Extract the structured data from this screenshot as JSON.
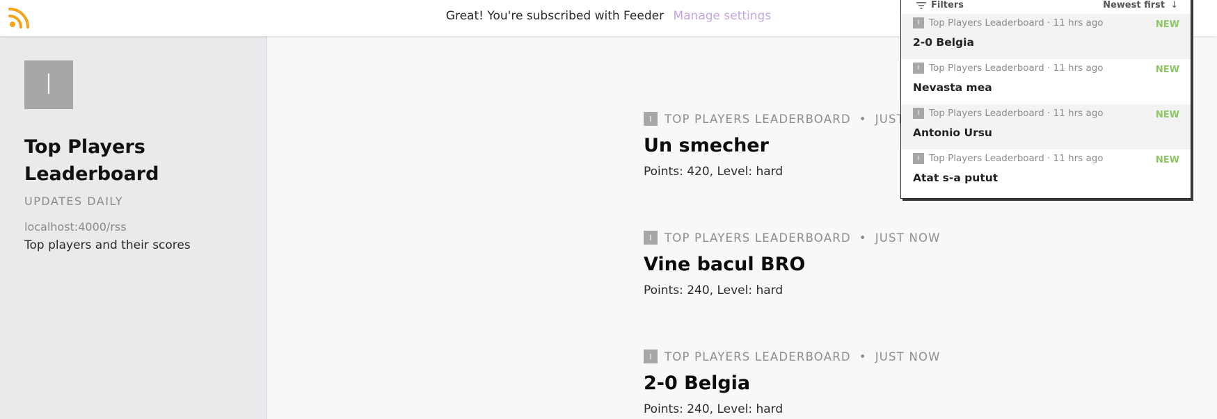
{
  "banner": {
    "message": "Great! You're subscribed with Feeder",
    "manage_label": "Manage settings"
  },
  "colors": {
    "rss_orange": "#f5a31a",
    "new_green": "#8cc665",
    "manage_purple": "#c3a6e2",
    "avatar_gray": "#a7a7a7"
  },
  "feed": {
    "avatar_letter": "I",
    "title": "Top Players Leaderboard",
    "subtitle": "UPDATES DAILY",
    "url": "localhost:4000/rss",
    "description": "Top players and their scores"
  },
  "posts": [
    {
      "source": "TOP PLAYERS LEADERBOARD",
      "time": "JUST NOW",
      "title": "Un smecher",
      "body": "Points: 420, Level: hard"
    },
    {
      "source": "TOP PLAYERS LEADERBOARD",
      "time": "JUST NOW",
      "title": "Vine bacul BRO",
      "body": "Points: 240, Level: hard"
    },
    {
      "source": "TOP PLAYERS LEADERBOARD",
      "time": "JUST NOW",
      "title": "2-0 Belgia",
      "body": "Points: 240, Level: hard"
    }
  ],
  "panel": {
    "filters_label": "Filters",
    "sort_label": "Newest first",
    "items": [
      {
        "meta": "Top Players Leaderboard · 11 hrs ago",
        "badge": "NEW",
        "title": "2-0 Belgia"
      },
      {
        "meta": "Top Players Leaderboard · 11 hrs ago",
        "badge": "NEW",
        "title": "Nevasta mea"
      },
      {
        "meta": "Top Players Leaderboard · 11 hrs ago",
        "badge": "NEW",
        "title": "Antonio Ursu"
      },
      {
        "meta": "Top Players Leaderboard · 11 hrs ago",
        "badge": "NEW",
        "title": "Atat s-a putut"
      }
    ]
  }
}
